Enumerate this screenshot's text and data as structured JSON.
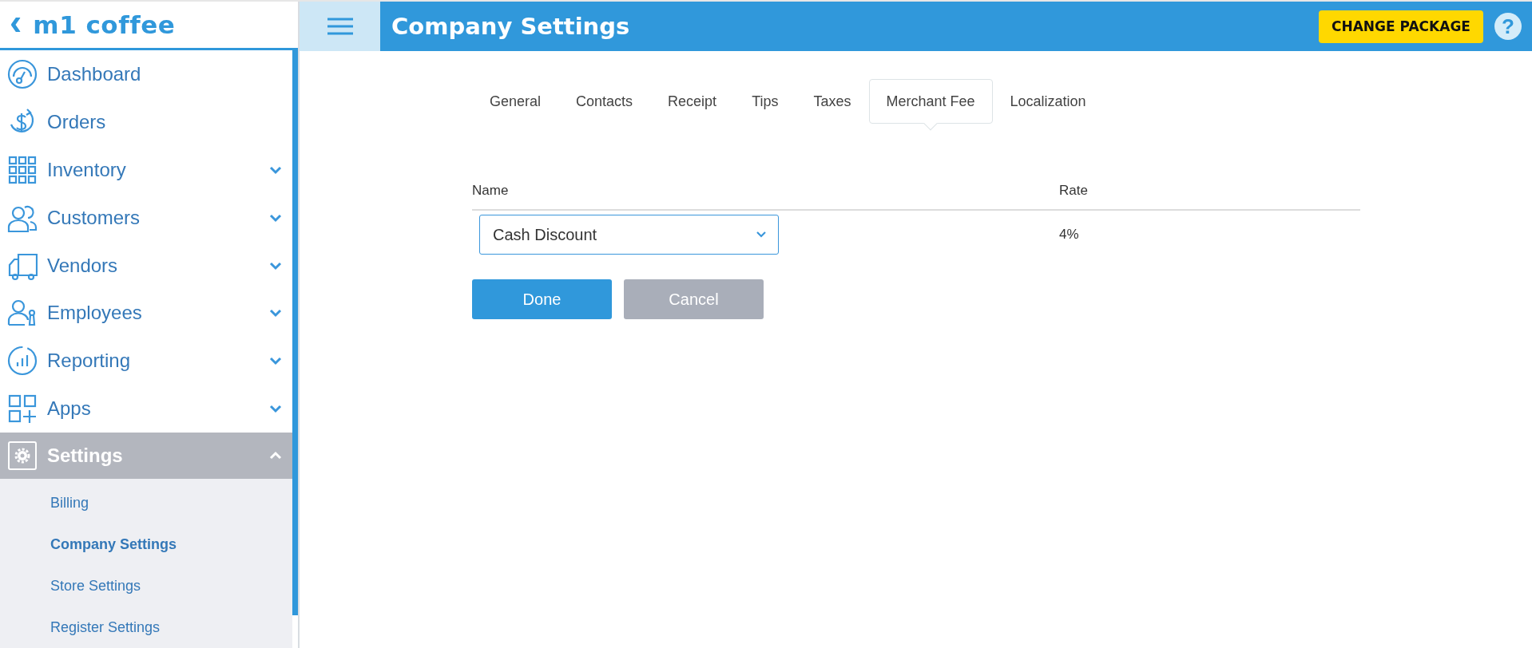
{
  "sidebar": {
    "back": "‹",
    "brand": "m1 coffee",
    "items": [
      {
        "label": "Dashboard",
        "kind": "link",
        "selected": false
      },
      {
        "label": "Orders",
        "kind": "link",
        "selected": false
      },
      {
        "label": "Inventory",
        "kind": "group",
        "expanded": false,
        "selected": false
      },
      {
        "label": "Customers",
        "kind": "group",
        "expanded": false,
        "selected": false
      },
      {
        "label": "Vendors",
        "kind": "group",
        "expanded": false,
        "selected": false
      },
      {
        "label": "Employees",
        "kind": "group",
        "expanded": false,
        "selected": false
      },
      {
        "label": "Reporting",
        "kind": "group",
        "expanded": false,
        "selected": false
      },
      {
        "label": "Apps",
        "kind": "group",
        "expanded": false,
        "selected": false
      },
      {
        "label": "Settings",
        "kind": "group",
        "expanded": true,
        "selected": true,
        "children": [
          {
            "label": "Billing",
            "selected": false
          },
          {
            "label": "Company Settings",
            "selected": true
          },
          {
            "label": "Store Settings",
            "selected": false
          },
          {
            "label": "Register Settings",
            "selected": false
          }
        ]
      }
    ]
  },
  "header": {
    "title": "Company Settings",
    "change_package": "CHANGE PACKAGE",
    "help": "?"
  },
  "tabs": [
    {
      "label": "General",
      "selected": false
    },
    {
      "label": "Contacts",
      "selected": false
    },
    {
      "label": "Receipt",
      "selected": false
    },
    {
      "label": "Tips",
      "selected": false
    },
    {
      "label": "Taxes",
      "selected": false
    },
    {
      "label": "Merchant Fee",
      "selected": true
    },
    {
      "label": "Localization",
      "selected": false
    }
  ],
  "table": {
    "columns": [
      "Name",
      "Rate"
    ],
    "rows": [
      {
        "name": "Cash Discount",
        "rate": "4%"
      }
    ]
  },
  "buttons": [
    {
      "label": "Done",
      "disabled": false
    },
    {
      "label": "Cancel",
      "disabled": true
    }
  ]
}
